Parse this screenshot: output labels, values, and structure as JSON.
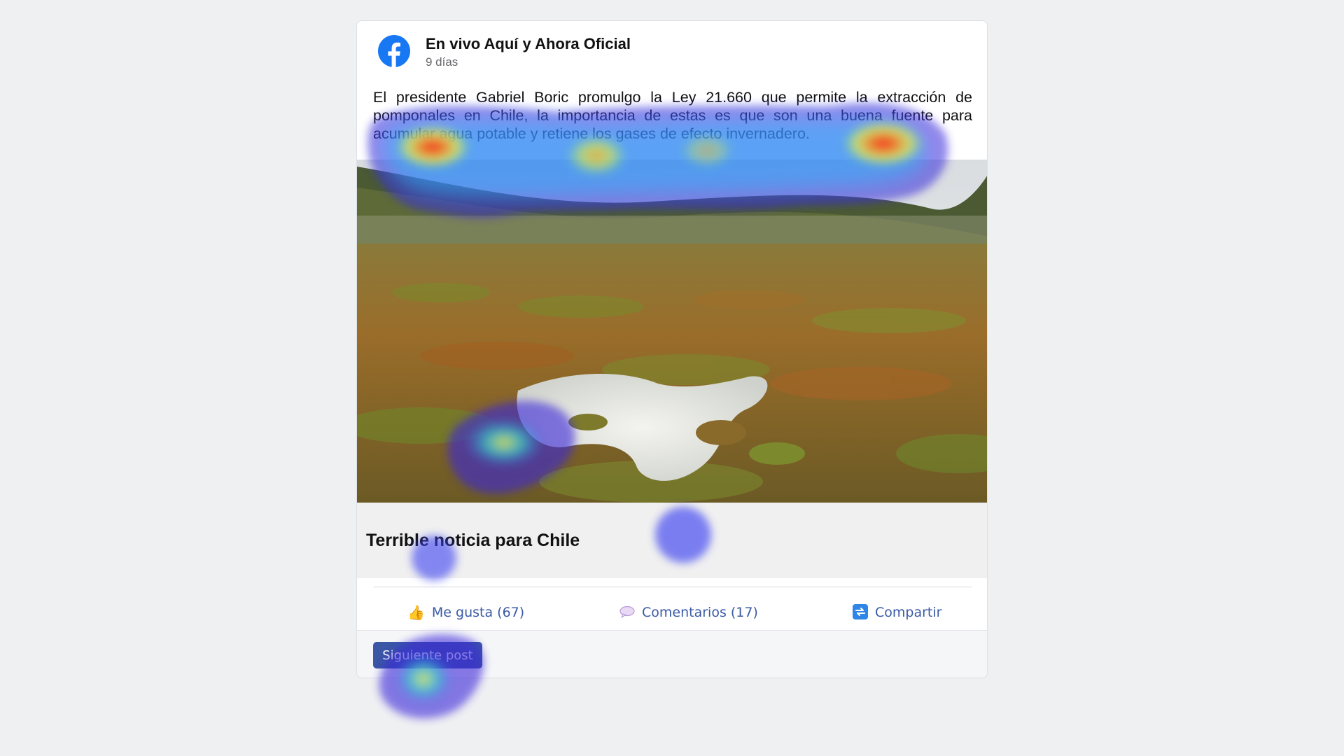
{
  "post": {
    "author": "En vivo Aquí y Ahora Oficial",
    "time": "9 días",
    "text": "El presidente Gabriel Boric promulgo la Ley 21.660 que permite la extracción de pomponales en Chile, la importancia de estas es que son una buena fuente para acumular agua potable y retiene los gases de efecto invernadero."
  },
  "link_preview": {
    "title": "Terrible noticia para Chile"
  },
  "actions": {
    "like_label": "Me gusta (67)",
    "comment_label": "Comentarios (17)",
    "share_label": "Compartir"
  },
  "footer": {
    "next_label": "Siguiente post"
  },
  "icons": {
    "logo": "facebook-logo-icon",
    "like": "thumbs-up-icon",
    "comment": "speech-bubble-icon",
    "share": "share-icon"
  },
  "colors": {
    "brand": "#1877f2",
    "action_text": "#3a5aa6",
    "button": "#3b57a5"
  }
}
